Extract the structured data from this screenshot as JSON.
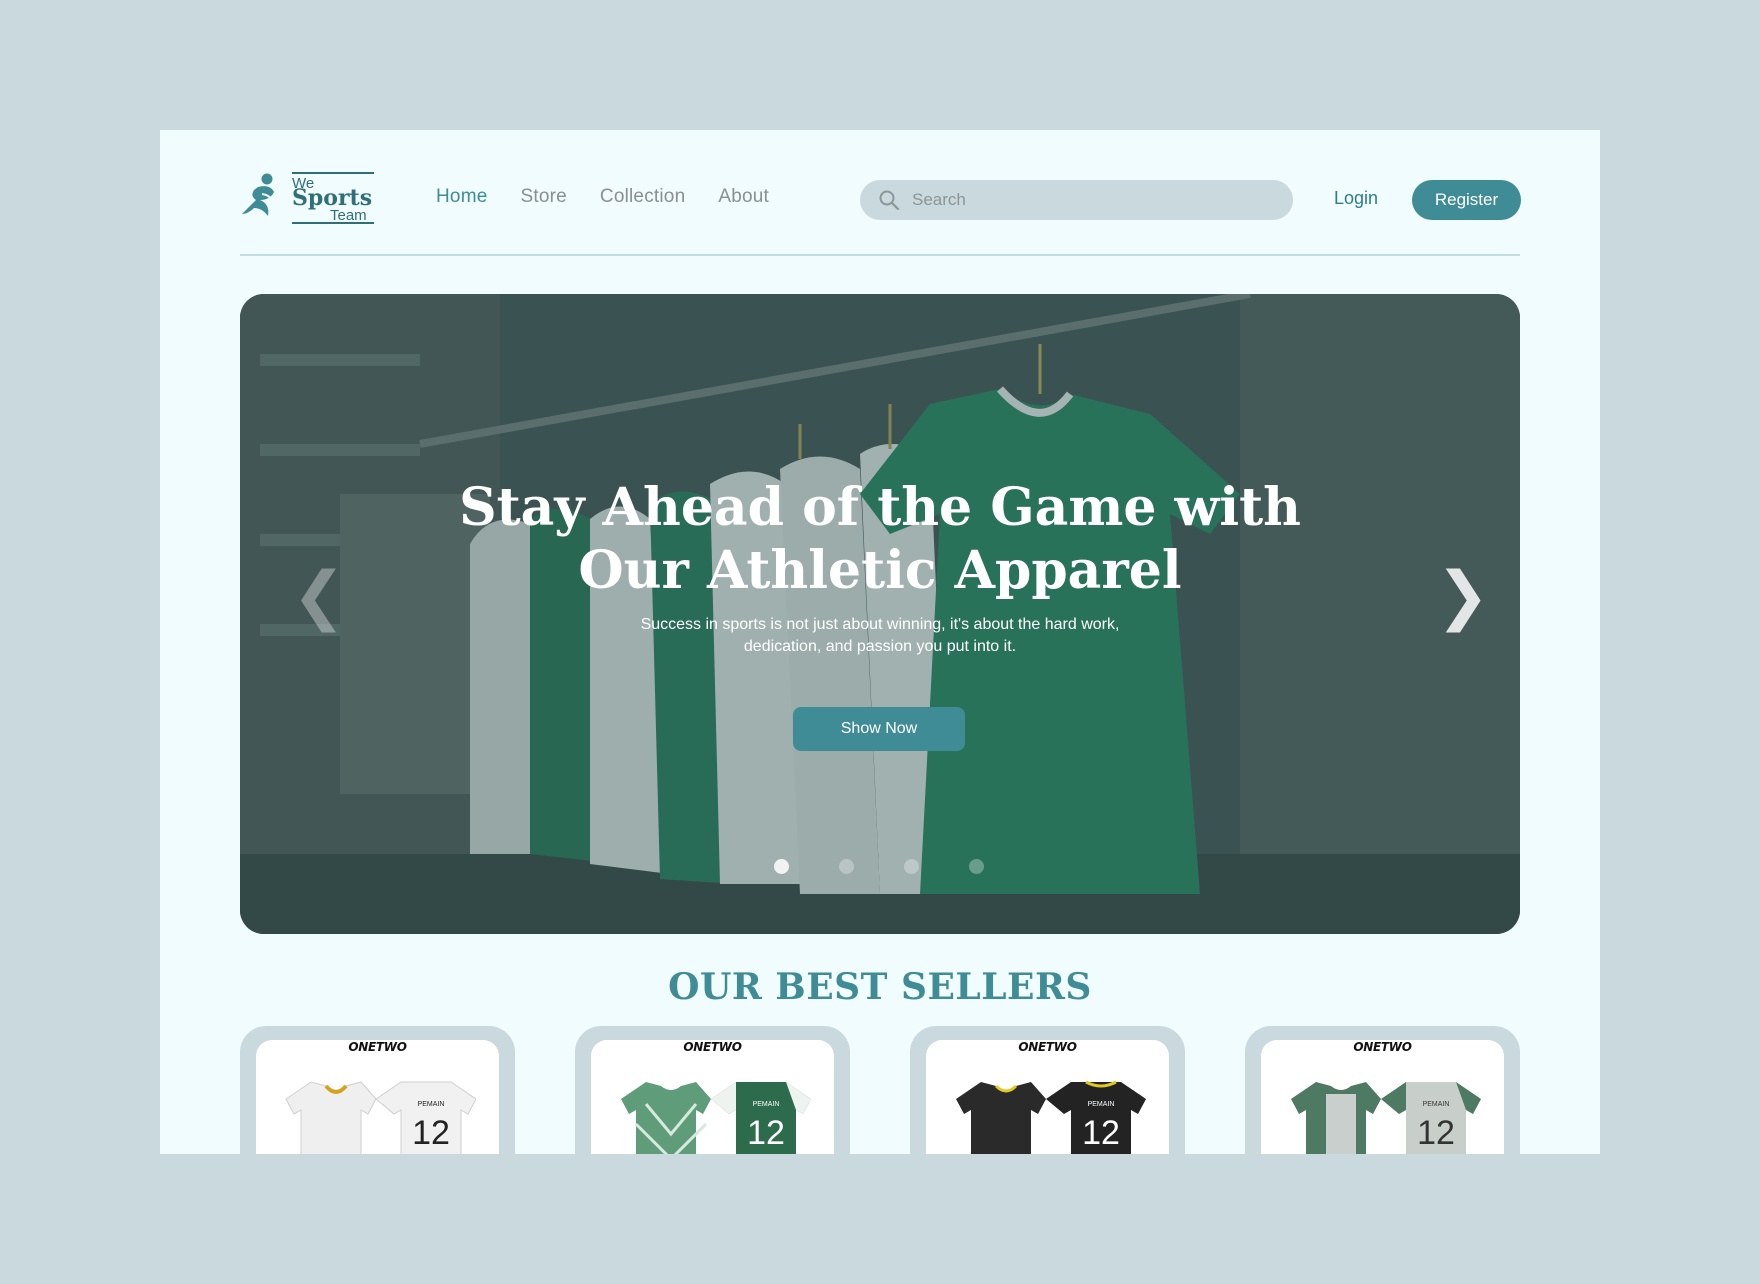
{
  "logo": {
    "line1": "We",
    "line2": "Sports",
    "line3": "Team"
  },
  "nav": [
    {
      "label": "Home",
      "active": true
    },
    {
      "label": "Store",
      "active": false
    },
    {
      "label": "Collection",
      "active": false
    },
    {
      "label": "About",
      "active": false
    }
  ],
  "search": {
    "placeholder": "Search",
    "icon": "search-icon"
  },
  "auth": {
    "login_label": "Login",
    "register_label": "Register"
  },
  "hero": {
    "title_line1": "Stay Ahead of the Game with",
    "title_line2": "Our Athletic Apparel",
    "subtitle_line1": "Success in sports is not just about winning, it's about the hard work,",
    "subtitle_line2": "dedication, and passion you put into it.",
    "cta_label": "Show Now",
    "prev_icon": "chevron-left-icon",
    "next_icon": "chevron-right-icon",
    "slide_count": 4,
    "active_slide": 1
  },
  "best_sellers": {
    "title": "OUR BEST SELLERS",
    "products": [
      {
        "brand": "ONETWO",
        "number": "12",
        "name_on_back": "PEMAIN",
        "colorway": "white-black"
      },
      {
        "brand": "ONETWO",
        "number": "12",
        "name_on_back": "PEMAIN",
        "colorway": "green-white"
      },
      {
        "brand": "ONETWO",
        "number": "12",
        "name_on_back": "PEMAIN",
        "colorway": "black-yellow"
      },
      {
        "brand": "ONETWO",
        "number": "12",
        "name_on_back": "PEMAIN",
        "colorway": "grey-green"
      }
    ]
  },
  "colors": {
    "accent": "#3f8c96",
    "page_bg": "#c9d9dd",
    "frame_bg": "#f1fcfe",
    "nav_inactive": "#8a8f91"
  }
}
